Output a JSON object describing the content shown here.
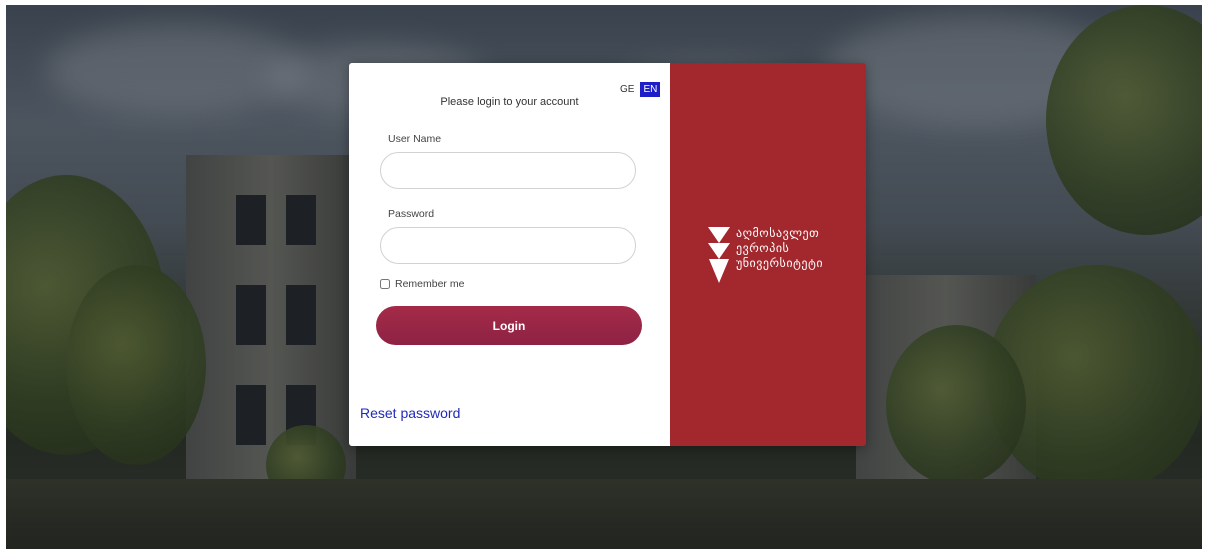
{
  "language": {
    "ge": "GE",
    "en": "EN",
    "active": "EN",
    "active_color": "#1d1ec7"
  },
  "login": {
    "subtitle": "Please login to your account",
    "username_label": "User Name",
    "username_value": "",
    "password_label": "Password",
    "password_value": "",
    "remember_label": "Remember me",
    "remember_checked": false,
    "button_label": "Login",
    "reset_link": "Reset password"
  },
  "brand": {
    "line1": "აღმოსავლეთ",
    "line2": "ევროპის",
    "line3": "უნივერსიტეტი",
    "panel_color": "#a2282e",
    "logo_icon": "triple-triangle-logo-icon"
  },
  "colors": {
    "button_gradient_start": "#a42b48",
    "button_gradient_end": "#8e2244",
    "link": "#1f2bb8"
  }
}
